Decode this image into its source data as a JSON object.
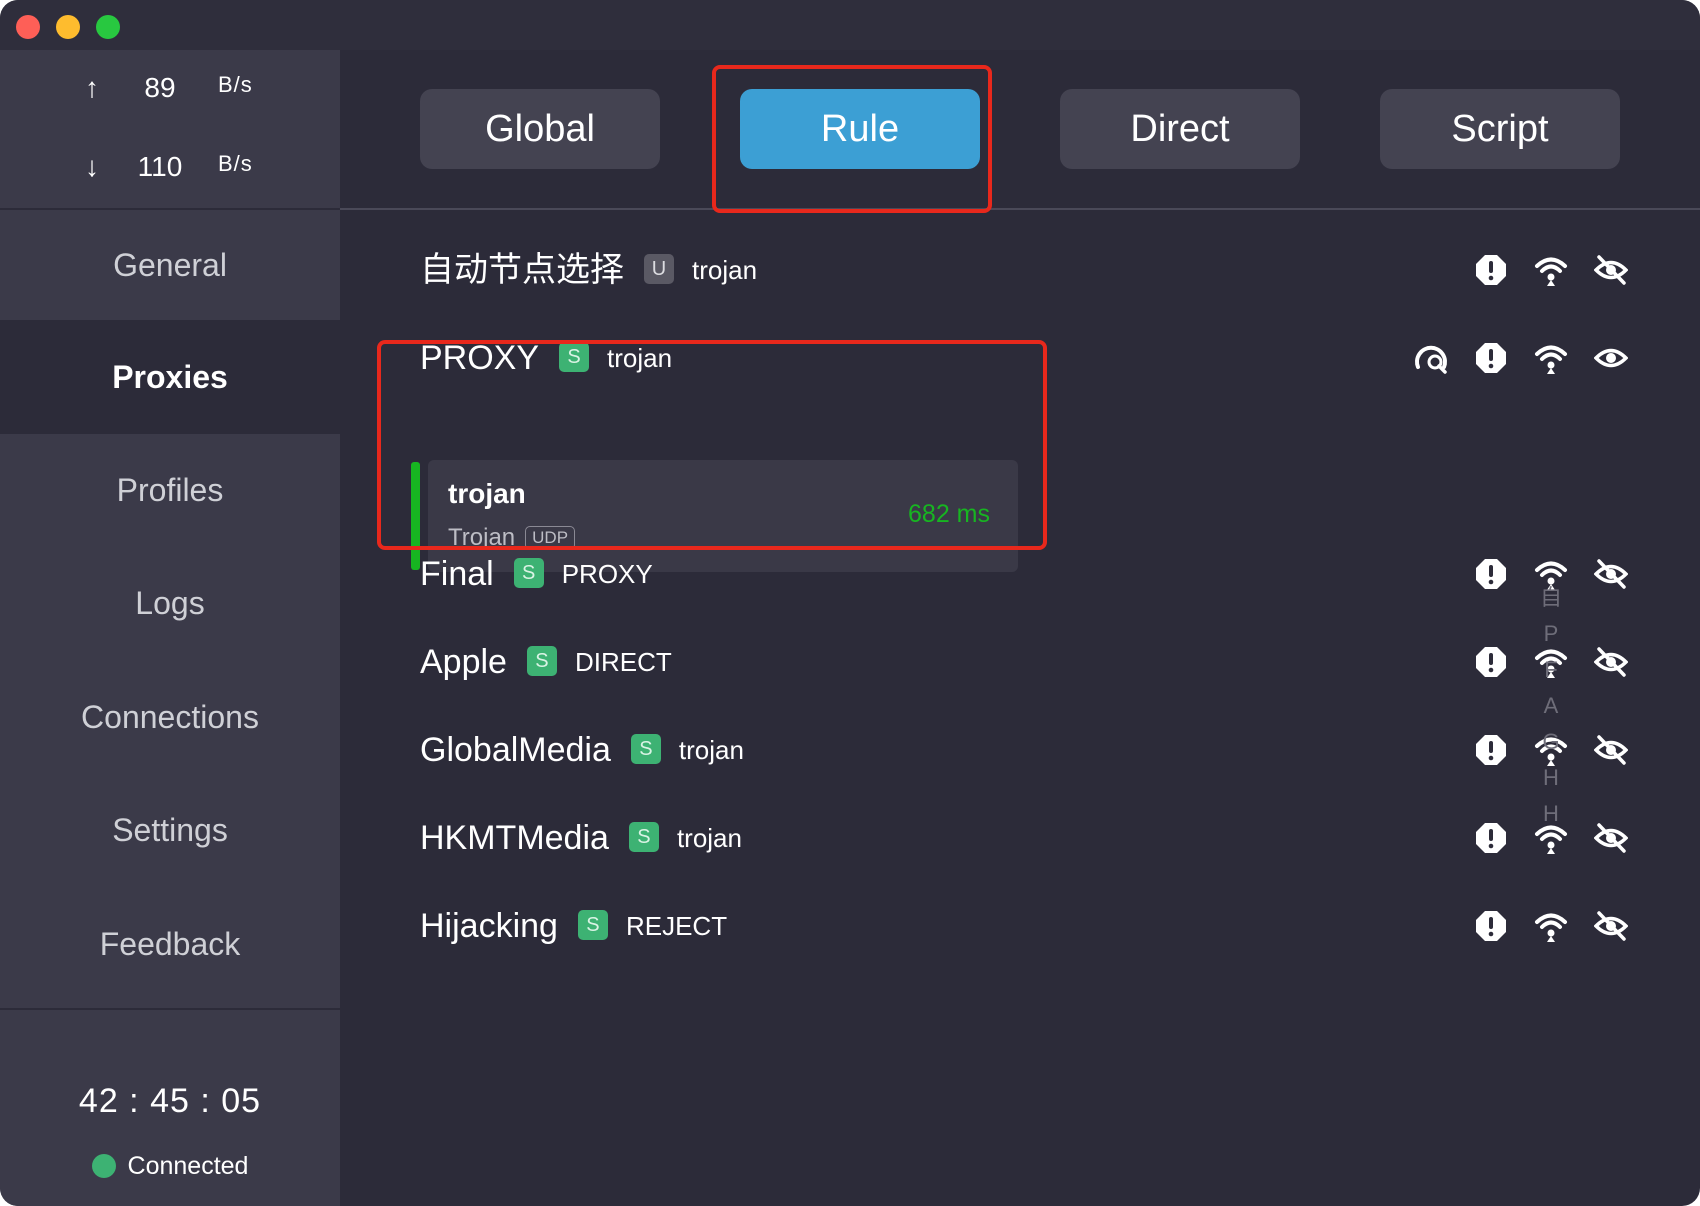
{
  "traffic": {
    "up": {
      "arrow": "↑",
      "value": "89",
      "unit": "B/s"
    },
    "down": {
      "arrow": "↓",
      "value": "110",
      "unit": "B/s"
    }
  },
  "sidebar": {
    "items": [
      {
        "label": "General"
      },
      {
        "label": "Proxies"
      },
      {
        "label": "Profiles"
      },
      {
        "label": "Logs"
      },
      {
        "label": "Connections"
      },
      {
        "label": "Settings"
      },
      {
        "label": "Feedback"
      }
    ],
    "active": "Proxies",
    "timer": "42 : 45 : 05",
    "status": "Connected"
  },
  "modes": {
    "items": [
      {
        "label": "Global"
      },
      {
        "label": "Rule"
      },
      {
        "label": "Direct"
      },
      {
        "label": "Script"
      }
    ],
    "active": "Rule"
  },
  "groups": [
    {
      "name": "自动节点选择",
      "badge": "U",
      "selected": "trojan"
    },
    {
      "name": "PROXY",
      "badge": "S",
      "selected": "trojan"
    },
    {
      "name": "Final",
      "badge": "S",
      "selected": "PROXY"
    },
    {
      "name": "Apple",
      "badge": "S",
      "selected": "DIRECT"
    },
    {
      "name": "GlobalMedia",
      "badge": "S",
      "selected": "trojan"
    },
    {
      "name": "HKMTMedia",
      "badge": "S",
      "selected": "trojan"
    },
    {
      "name": "Hijacking",
      "badge": "S",
      "selected": "REJECT"
    }
  ],
  "proxy_card": {
    "name": "trojan",
    "type": "Trojan",
    "tag": "UDP",
    "latency": "682 ms"
  },
  "index": [
    "自",
    "P",
    "F",
    "A",
    "G",
    "H",
    "H"
  ],
  "colors": {
    "accent": "#3c9fd4",
    "highlight": "#e8281c",
    "badge": "#3db273",
    "latency": "#17b521",
    "background": "#2c2b39",
    "sidebar": "#3b3a49"
  },
  "icons": {
    "row": [
      "alert-octagon-icon",
      "wifi-icon",
      "eye-off-icon"
    ],
    "expanded": [
      "speed-search-icon",
      "alert-octagon-icon",
      "wifi-icon",
      "eye-icon"
    ]
  }
}
